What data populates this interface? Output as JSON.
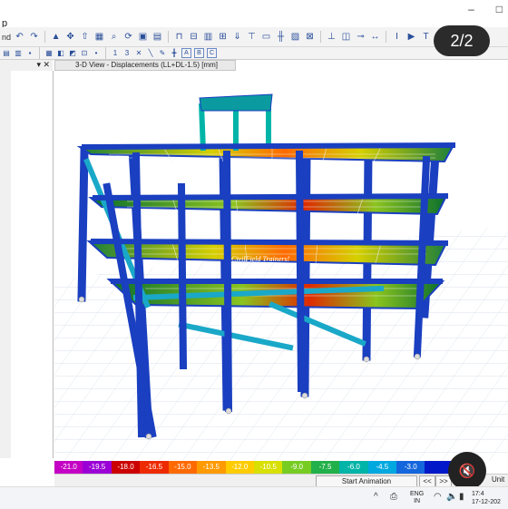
{
  "titlebar": {
    "app_label": "p",
    "minimize": "–",
    "maximize": "□"
  },
  "toolbar": {
    "left_text": "nd",
    "number_1": "1",
    "number_3": "3",
    "icon_T": "T",
    "icon_I": "I"
  },
  "toolbar2": {
    "box_a": "A",
    "box_b": "B",
    "box_c": "C"
  },
  "page_counter": "2/2",
  "view_tab": {
    "title": "3-D View  - Displacements (LL+DL-1.5) [mm]"
  },
  "watermark": "CivilField Trainers!",
  "legend": {
    "values": [
      "-21.0",
      "-19.5",
      "-18.0",
      "-16.5",
      "-15.0",
      "-13.5",
      "-12.0",
      "-10.5",
      "-9.0",
      "-7.5",
      "-6.0",
      "-4.5",
      "-3.0",
      ""
    ],
    "colors": [
      "#c400c4",
      "#9a00d6",
      "#cc0000",
      "#ee2a00",
      "#ff6a00",
      "#ff9a00",
      "#ffcc00",
      "#d8e000",
      "#77cc22",
      "#22b04a",
      "#00b4a8",
      "#00a8e0",
      "#1466dd",
      "#0018c8"
    ]
  },
  "bottom": {
    "start_animation": "Start Animation",
    "prev": "<<",
    "next": ">>",
    "units": "Unit"
  },
  "taskbar": {
    "lang_top": "ENG",
    "lang_bottom": "IN",
    "time": "17:4",
    "date": "17-12-202"
  }
}
